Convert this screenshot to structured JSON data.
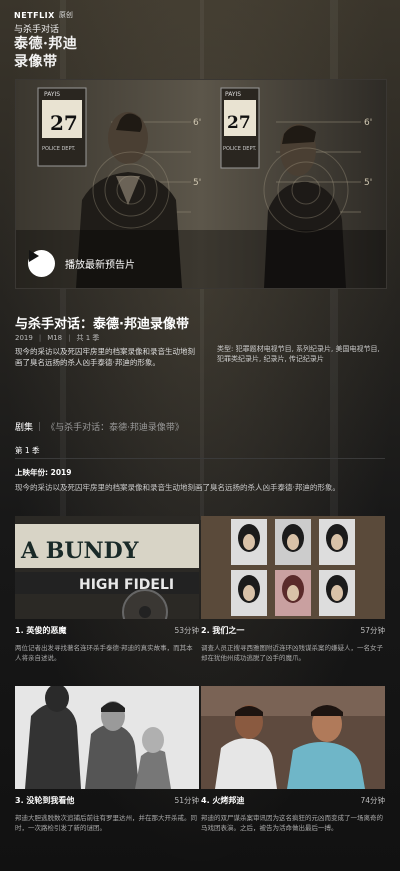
{
  "header": {
    "brand": "NETFLIX",
    "brand_tag": "原创",
    "show_name_small": "与杀手对话",
    "logo_line1": "泰德·邦迪",
    "logo_line2": "录像带"
  },
  "hero": {
    "play_label": "播放最新预告片",
    "board_left": {
      "sign": "PAYIS",
      "date": "27",
      "dept": "POLICE DEPT."
    },
    "board_right": {
      "sign": "PAYIS",
      "date": "27",
      "dept": "POLICE DEPT."
    },
    "height_marks": [
      "6'",
      "5'",
      "6'",
      "5'"
    ]
  },
  "show": {
    "title": "与杀手对话：泰德·邦迪录像带",
    "year": "2019",
    "rating": "M18",
    "seasons": "共 1 季",
    "description": "现今的采访以及死囚牢房里的档案录像和录音生动地刻画了臭名远扬的杀人凶手泰德·邦迪的形象。",
    "genres": "类型: 犯罪题材电视节目, 系列纪录片, 美国电视节目, 犯罪类纪录片, 纪录片, 传记纪录片"
  },
  "episodes_section": {
    "heading": "剧集",
    "subheading": "《与杀手对话：泰德·邦迪录像带》",
    "season_label": "第 1 季",
    "release": "上映年份: 2019",
    "season_desc": "现今的采访以及死囚牢房里的档案录像和录音生动地刻画了臭名远扬的杀人凶手泰德·邦迪的形象。"
  },
  "episodes": [
    {
      "title": "1. 英俊的恶魔",
      "duration": "53分钟",
      "desc": "两位记者出发寻找著名连环杀手泰德·邦迪的真实故事，而其本人将亲自述说。",
      "thumb_text_top": "A  BUNDY",
      "thumb_text_bottom": "HIGH FIDELI"
    },
    {
      "title": "2. 我们之一",
      "duration": "57分钟",
      "desc": "调查人员正搜寻西雅图附近连环凶残谋杀案的嫌疑人，一名女子却在犹他州成功逃脱了凶手的魔爪。"
    },
    {
      "title": "3. 没轮到我看他",
      "duration": "51分钟",
      "desc": "邦迪大胆逃脱数次追捕后前往有罗里达州，并在那大开杀戒。同时，一次路检引发了新的谜团。"
    },
    {
      "title": "4. 火烤邦迪",
      "duration": "74分钟",
      "desc": "邦迪的双尸谋杀案审讯因为这名疯狂的元凶而变成了一场离奇的马戏团表演。之后，被告为活命做出最后一搏。"
    }
  ],
  "colors": {
    "background": "#141414",
    "accent": "#ffffff"
  }
}
